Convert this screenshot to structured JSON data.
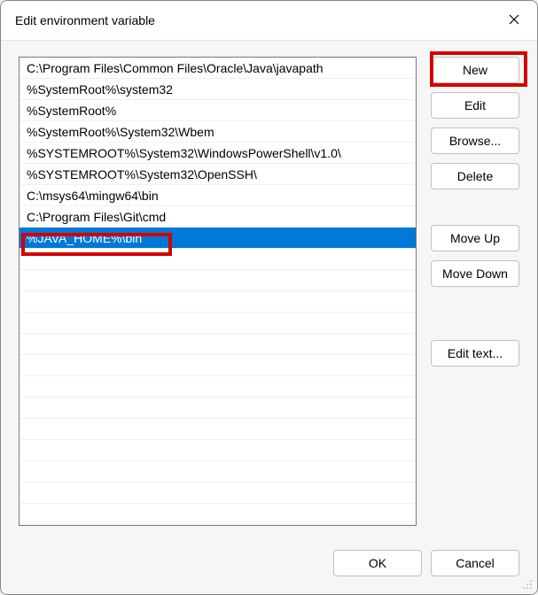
{
  "dialog": {
    "title": "Edit environment variable"
  },
  "list": {
    "items": [
      "C:\\Program Files\\Common Files\\Oracle\\Java\\javapath",
      "%SystemRoot%\\system32",
      "%SystemRoot%",
      "%SystemRoot%\\System32\\Wbem",
      "%SYSTEMROOT%\\System32\\WindowsPowerShell\\v1.0\\",
      "%SYSTEMROOT%\\System32\\OpenSSH\\",
      "C:\\msys64\\mingw64\\bin",
      "C:\\Program Files\\Git\\cmd",
      "%JAVA_HOME%\\bin"
    ],
    "selected_index": 8
  },
  "buttons": {
    "new": "New",
    "edit": "Edit",
    "browse": "Browse...",
    "delete": "Delete",
    "move_up": "Move Up",
    "move_down": "Move Down",
    "edit_text": "Edit text...",
    "ok": "OK",
    "cancel": "Cancel"
  }
}
